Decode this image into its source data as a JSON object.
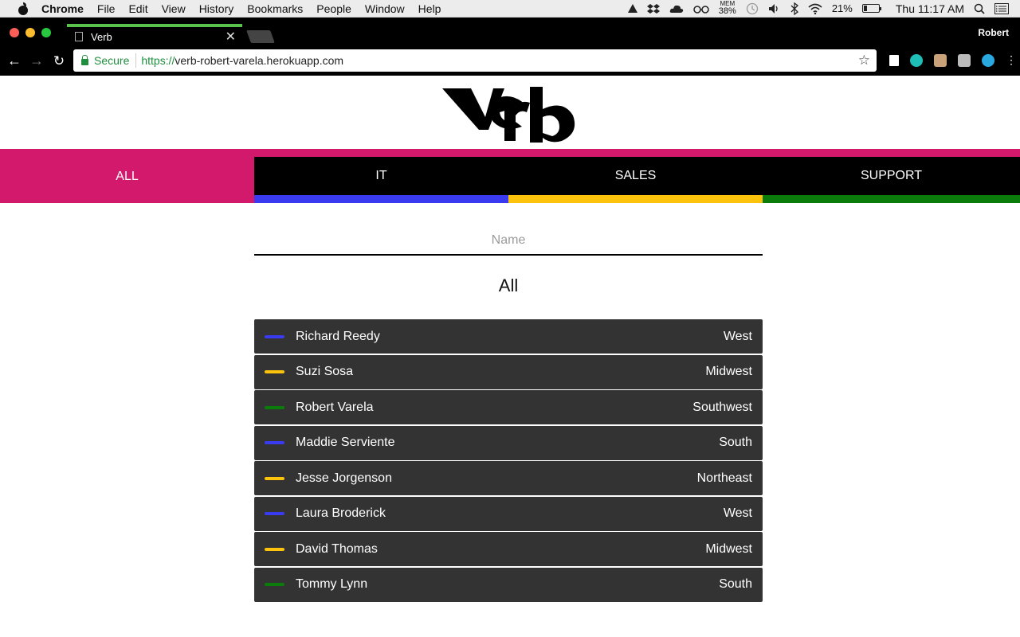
{
  "menubar": {
    "app": "Chrome",
    "items": [
      "File",
      "Edit",
      "View",
      "History",
      "Bookmarks",
      "People",
      "Window",
      "Help"
    ],
    "mem_label": "MEM",
    "mem_value": "38%",
    "battery": "21%",
    "clock": "Thu 11:17 AM"
  },
  "browser": {
    "tab_title": "Verb",
    "profile": "Robert",
    "secure_label": "Secure",
    "url_scheme": "https://",
    "url_host": "verb-robert-varela.herokuapp.com"
  },
  "colors": {
    "all": "#d2196b",
    "it": "#3a3af0",
    "sales": "#fcc20c",
    "support": "#0b7c0b"
  },
  "nav": {
    "tabs": [
      {
        "label": "ALL",
        "color_key": "all"
      },
      {
        "label": "IT",
        "color_key": "it"
      },
      {
        "label": "SALES",
        "color_key": "sales"
      },
      {
        "label": "SUPPORT",
        "color_key": "support"
      }
    ]
  },
  "filter": {
    "placeholder": "Name",
    "value": ""
  },
  "list": {
    "heading": "All",
    "people": [
      {
        "name": "Richard Reedy",
        "region": "West",
        "dept": "it"
      },
      {
        "name": "Suzi Sosa",
        "region": "Midwest",
        "dept": "sales"
      },
      {
        "name": "Robert Varela",
        "region": "Southwest",
        "dept": "support"
      },
      {
        "name": "Maddie Serviente",
        "region": "South",
        "dept": "it"
      },
      {
        "name": "Jesse Jorgenson",
        "region": "Northeast",
        "dept": "sales"
      },
      {
        "name": "Laura Broderick",
        "region": "West",
        "dept": "it"
      },
      {
        "name": "David Thomas",
        "region": "Midwest",
        "dept": "sales"
      },
      {
        "name": "Tommy Lynn",
        "region": "South",
        "dept": "support"
      }
    ]
  }
}
